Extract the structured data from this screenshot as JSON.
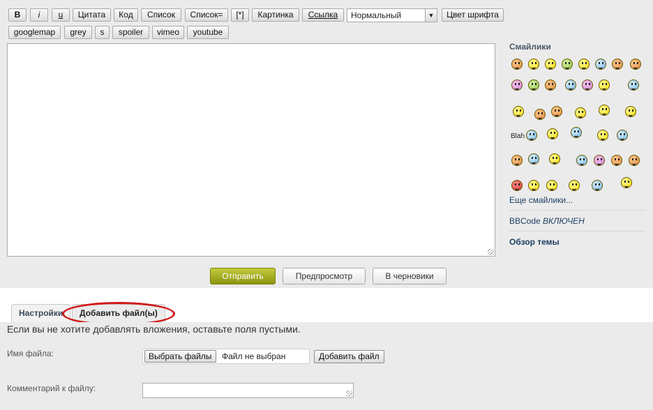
{
  "toolbar": {
    "row1": [
      "B",
      "i",
      "u",
      "Цитата",
      "Код",
      "Список",
      "Список=",
      "[*]",
      "Картинка",
      "Ссылка"
    ],
    "font_size_select": "Нормальный",
    "font_color_button": "Цвет шрифта",
    "row2": [
      "googlemap",
      "grey",
      "s",
      "spoiler",
      "vimeo",
      "youtube"
    ]
  },
  "sidebar": {
    "smilies_title": "Смайлики",
    "more_smilies": "Еще смайлики...",
    "bbcode_label": "BBCode",
    "bbcode_state": "ВКЛЮЧЕН",
    "topic_review": "Обзор темы",
    "smiley_colors": {
      "yellow": "#ffd800",
      "orange": "#e08a3a",
      "pink": "#d27ad0",
      "blue": "#6cb3e8",
      "red": "#d43030",
      "green": "#8cbf3c"
    },
    "blah_text": "Blah"
  },
  "actions": {
    "submit": "Отправить",
    "preview": "Предпросмотр",
    "draft": "В черновики"
  },
  "tabs": {
    "settings": "Настройки",
    "add_files": "Добавить файл(ы)"
  },
  "attachments": {
    "note": "Если вы не хотите добавлять вложения, оставьте поля пустыми.",
    "filename_label": "Имя файла:",
    "choose_button": "Выбрать файлы",
    "no_file": "Файл не выбран",
    "add_file_button": "Добавить файл",
    "comment_label": "Комментарий к файлу:"
  },
  "colors": {
    "submit_accent": "#a8b020",
    "highlight_oval": "#d11919",
    "link": "#1e3f62"
  }
}
